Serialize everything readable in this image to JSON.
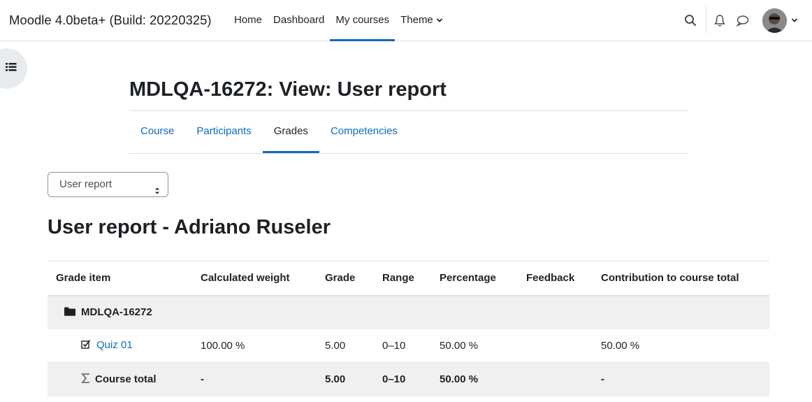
{
  "navbar": {
    "brand": "Moodle 4.0beta+ (Build: 20220325)",
    "links": [
      {
        "label": "Home",
        "active": false
      },
      {
        "label": "Dashboard",
        "active": false
      },
      {
        "label": "My courses",
        "active": true
      },
      {
        "label": "Theme",
        "active": false,
        "dropdown": true
      }
    ],
    "icons": [
      "search-icon",
      "bell-icon",
      "chat-icon",
      "user-avatar",
      "chevron-down-icon"
    ]
  },
  "drawer_toggle": {
    "icon": "course-index-icon"
  },
  "course": {
    "title": "MDLQA-16272: View: User report",
    "secondary_nav": [
      {
        "label": "Course",
        "active": false
      },
      {
        "label": "Participants",
        "active": false
      },
      {
        "label": "Grades",
        "active": true
      },
      {
        "label": "Competencies",
        "active": false
      }
    ]
  },
  "report_select": {
    "value": "User report"
  },
  "report": {
    "title": "User report - Adriano Ruseler",
    "headers": [
      "Grade item",
      "Calculated weight",
      "Grade",
      "Range",
      "Percentage",
      "Feedback",
      "Contribution to course total"
    ],
    "category": {
      "name": "MDLQA-16272",
      "icon": "folder-icon"
    },
    "item": {
      "name": "Quiz 01",
      "icon": "quiz-icon",
      "weight": "100.00 %",
      "grade": "5.00",
      "range": "0–10",
      "percentage": "50.00 %",
      "feedback": "",
      "contribution": "50.00 %"
    },
    "total": {
      "name": "Course total",
      "icon": "sigma-icon",
      "weight": "-",
      "grade": "5.00",
      "range": "0–10",
      "percentage": "50.00 %",
      "feedback": "",
      "contribution": "-"
    }
  },
  "colors": {
    "link": "#0f6cbf",
    "text": "#1d2125",
    "border": "#dee2e6",
    "row_bg": "#f0f0f0"
  }
}
